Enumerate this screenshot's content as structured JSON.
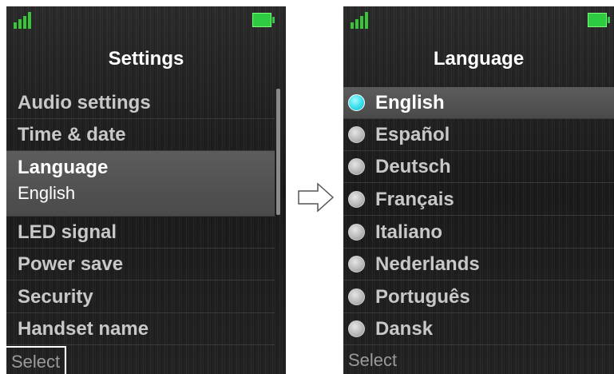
{
  "left_screen": {
    "title": "Settings",
    "items": [
      {
        "label": "Audio settings"
      },
      {
        "label": "Time & date"
      },
      {
        "label": "Language",
        "sub": "English"
      },
      {
        "label": "LED signal"
      },
      {
        "label": "Power save"
      },
      {
        "label": "Security"
      },
      {
        "label": "Handset name"
      }
    ],
    "selected_index": 2,
    "softkey_left": "Select"
  },
  "right_screen": {
    "title": "Language",
    "items": [
      {
        "label": "English"
      },
      {
        "label": "Español"
      },
      {
        "label": "Deutsch"
      },
      {
        "label": "Français"
      },
      {
        "label": "Italiano"
      },
      {
        "label": "Nederlands"
      },
      {
        "label": "Português"
      },
      {
        "label": "Dansk"
      }
    ],
    "selected_index": 0,
    "softkey_left": "Select"
  },
  "icons": {
    "signal": "signal-bars-icon",
    "battery": "battery-icon",
    "arrow": "right-arrow-icon",
    "radio": "radio-button-icon"
  },
  "colors": {
    "accent_signal": "#39c53a",
    "battery": "#2ecc40",
    "radio_selected": "#3de0ee",
    "selection_bg": "#555555"
  }
}
